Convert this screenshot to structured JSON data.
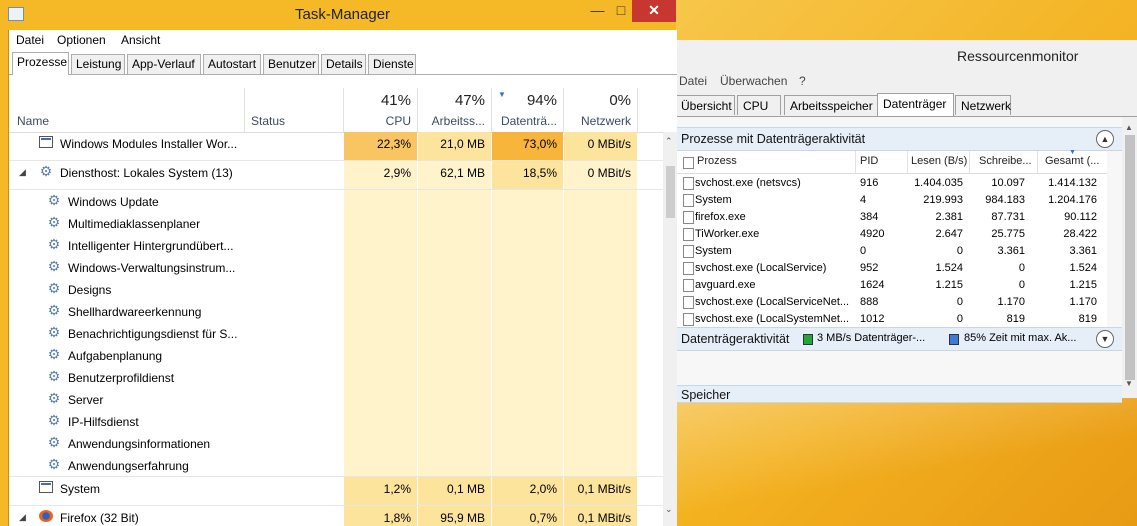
{
  "task_manager": {
    "title": "Task-Manager",
    "menu": [
      "Datei",
      "Optionen",
      "Ansicht"
    ],
    "tabs": [
      "Prozesse",
      "Leistung",
      "App-Verlauf",
      "Autostart",
      "Benutzer",
      "Details",
      "Dienste"
    ],
    "columns": {
      "name": "Name",
      "status": "Status",
      "cpu": {
        "pct": "41%",
        "label": "CPU"
      },
      "mem": {
        "pct": "47%",
        "label": "Arbeitss..."
      },
      "disk": {
        "pct": "94%",
        "label": "Datenträ..."
      },
      "net": {
        "pct": "0%",
        "label": "Netzwerk"
      }
    },
    "rows": [
      {
        "name": "Windows Modules Installer Wor...",
        "cpu": "22,3%",
        "mem": "21,0 MB",
        "disk": "73,0%",
        "net": "0 MBit/s"
      },
      {
        "name": "Diensthost: Lokales System (13)",
        "cpu": "2,9%",
        "mem": "62,1 MB",
        "disk": "18,5%",
        "net": "0 MBit/s"
      }
    ],
    "services": [
      "Windows Update",
      "Multimediaklassenplaner",
      "Intelligenter Hintergrundübert...",
      "Windows-Verwaltungsinstrum...",
      "Designs",
      "Shellhardwareerkennung",
      "Benachrichtigungsdienst für S...",
      "Aufgabenplanung",
      "Benutzerprofildienst",
      "Server",
      "IP-Hilfsdienst",
      "Anwendungsinformationen",
      "Anwendungserfahrung"
    ],
    "bottom_rows": [
      {
        "name": "System",
        "cpu": "1,2%",
        "mem": "0,1 MB",
        "disk": "2,0%",
        "net": "0,1 MBit/s"
      },
      {
        "name": "Firefox (32 Bit)",
        "cpu": "1,8%",
        "mem": "95,9 MB",
        "disk": "0,7%",
        "net": "0,1 MBit/s"
      }
    ]
  },
  "resource_monitor": {
    "title": "Ressourcenmonitor",
    "menu": [
      "Datei",
      "Überwachen",
      "?"
    ],
    "tabs": [
      "Übersicht",
      "CPU",
      "Arbeitsspeicher",
      "Datenträger",
      "Netzwerk"
    ],
    "section1": {
      "title": "Prozesse mit Datenträgeraktivität",
      "headers": [
        "Prozess",
        "PID",
        "Lesen (B/s)",
        "Schreibe...",
        "Gesamt (..."
      ],
      "rows": [
        {
          "name": "svchost.exe (netsvcs)",
          "pid": "916",
          "read": "1.404.035",
          "write": "10.097",
          "total": "1.414.132"
        },
        {
          "name": "System",
          "pid": "4",
          "read": "219.993",
          "write": "984.183",
          "total": "1.204.176"
        },
        {
          "name": "firefox.exe",
          "pid": "384",
          "read": "2.381",
          "write": "87.731",
          "total": "90.112"
        },
        {
          "name": "TiWorker.exe",
          "pid": "4920",
          "read": "2.647",
          "write": "25.775",
          "total": "28.422"
        },
        {
          "name": "System",
          "pid": "0",
          "read": "0",
          "write": "3.361",
          "total": "3.361"
        },
        {
          "name": "svchost.exe (LocalService)",
          "pid": "952",
          "read": "1.524",
          "write": "0",
          "total": "1.524"
        },
        {
          "name": "avguard.exe",
          "pid": "1624",
          "read": "1.215",
          "write": "0",
          "total": "1.215"
        },
        {
          "name": "svchost.exe (LocalServiceNet...",
          "pid": "888",
          "read": "0",
          "write": "1.170",
          "total": "1.170"
        },
        {
          "name": "svchost.exe (LocalSystemNet...",
          "pid": "1012",
          "read": "0",
          "write": "819",
          "total": "819"
        }
      ]
    },
    "section2": {
      "title": "Datenträgeraktivität",
      "stat1": "3 MB/s Datenträger-...",
      "stat2": "85% Zeit mit max. Ak..."
    },
    "section3": {
      "title": "Speicher"
    }
  },
  "colors": {
    "heat_high": "#f9c563",
    "heat_mid": "#fce49d",
    "heat_low": "#fff3cc",
    "close_red": "#c7372f",
    "window_frame": "#f5b928"
  }
}
